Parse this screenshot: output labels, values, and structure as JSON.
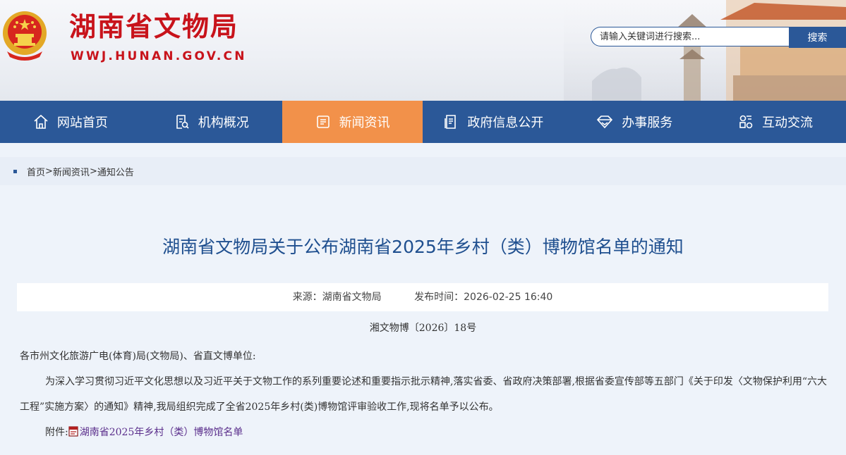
{
  "site": {
    "title": "湖南省文物局",
    "domain": "WWJ.HUNAN.GOV.CN"
  },
  "search": {
    "placeholder": "请输入关键词进行搜索...",
    "button": "搜索"
  },
  "nav": [
    {
      "label": "网站首页",
      "icon": "home-icon"
    },
    {
      "label": "机构概况",
      "icon": "org-doc-icon"
    },
    {
      "label": "新闻资讯",
      "icon": "news-icon",
      "active": true
    },
    {
      "label": "政府信息公开",
      "icon": "info-doc-icon"
    },
    {
      "label": "办事服务",
      "icon": "diamond-icon"
    },
    {
      "label": "互动交流",
      "icon": "interact-icon"
    }
  ],
  "breadcrumb": [
    "首页",
    "新闻资讯",
    "通知公告"
  ],
  "article": {
    "title": "湖南省文物局关于公布湖南省2025年乡村（类）博物馆名单的通知",
    "source": "来源：湖南省文物局",
    "publish_time": "发布时间：2026-02-25 16:40",
    "doc_no": "湘文物博〔2026〕18号",
    "salutation": "各市州文化旅游广电(体育)局(文物局)、省直文博单位:",
    "paragraph": "为深入学习贯彻习近平文化思想以及习近平关于文物工作的系列重要论述和重要指示批示精神,落实省委、省政府决策部署,根据省委宣传部等五部门《关于印发〈文物保护利用“六大工程”实施方案〉的通知》精神,我局组织完成了全省2025年乡村(类)博物馆评审验收工作,现将名单予以公布。",
    "attachment_label": "附件:",
    "attachment_link": "湖南省2025年乡村（类）博物馆名单"
  },
  "colors": {
    "brand_red": "#c8131b",
    "nav_blue": "#2b5898",
    "nav_active": "#f2914a",
    "title_blue": "#1f4f8f"
  }
}
